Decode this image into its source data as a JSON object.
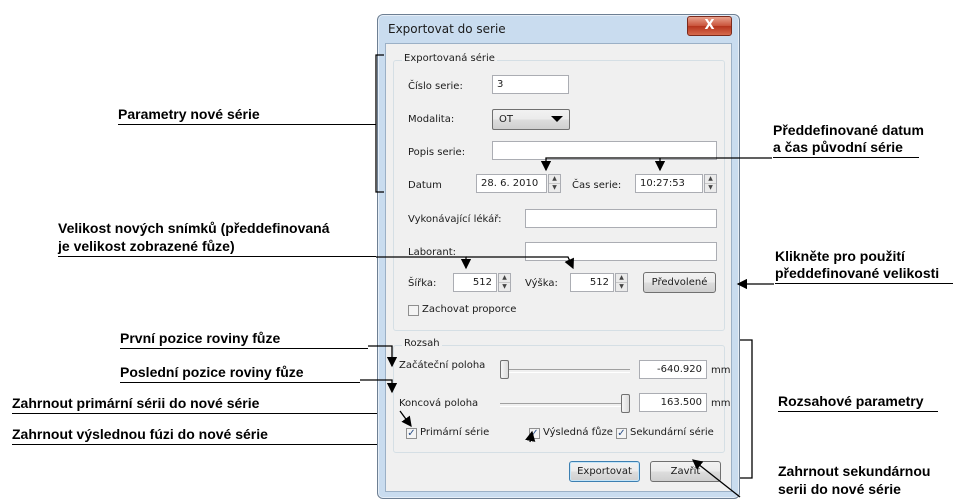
{
  "annotations": {
    "params": "Parametry nové série",
    "datetime_1": "Předdefinované datum",
    "datetime_2": "a čas původní série",
    "size_1": "Velikost nových snímků (předdefinovaná",
    "size_2": "je velikost zobrazené fůze)",
    "default_1": "Klikněte pro použití",
    "default_2": "předdefinované velikosti",
    "first_pos": "První pozice roviny fůze",
    "last_pos": "Poslední pozice roviny fůze",
    "include_primary": "Zahrnout primární sérii do nové série",
    "include_result": "Zahrnout výslednou fúzi do nové série",
    "range_params": "Rozsahové parametry",
    "include_secondary_1": "Zahrnout sekundárnou",
    "include_secondary_2": "serii do nové série"
  },
  "dialog": {
    "title": "Exportovat do serie",
    "close_symbol": "X",
    "group_export": {
      "title": "Exportovaná série",
      "series_number_label": "Číslo serie:",
      "series_number_value": "3",
      "modality_label": "Modalita:",
      "modality_value": "OT",
      "description_label": "Popis serie:",
      "description_value": "",
      "date_label": "Datum",
      "date_value": "28.  6. 2010",
      "time_label": "Čas serie:",
      "time_value": "10:27:53",
      "physician_label": "Vykonávající lékář:",
      "physician_value": "",
      "technician_label": "Laborant:",
      "technician_value": "",
      "width_label": "Šířka:",
      "width_value": "512",
      "height_label": "Výška:",
      "height_value": "512",
      "default_button": "Předvolené",
      "keep_proportions_label": "Zachovat proporce",
      "keep_proportions_checked": false
    },
    "group_range": {
      "title": "Rozsah",
      "start_label": "Začáteční poloha",
      "start_value": "-640.920",
      "start_unit": "mm",
      "start_slider_fraction": 0.0,
      "end_label": "Koncová poloha",
      "end_value": "163.500",
      "end_unit": "mm",
      "end_slider_fraction": 1.0,
      "primary_label": "Primární série",
      "primary_checked": true,
      "result_label": "Výsledná fůze",
      "result_checked": true,
      "secondary_label": "Sekundární série",
      "secondary_checked": true
    },
    "export_button": "Exportovat",
    "close_button": "Zavřít"
  },
  "check_mark": "✓",
  "spin_up": "▲",
  "spin_down": "▼"
}
